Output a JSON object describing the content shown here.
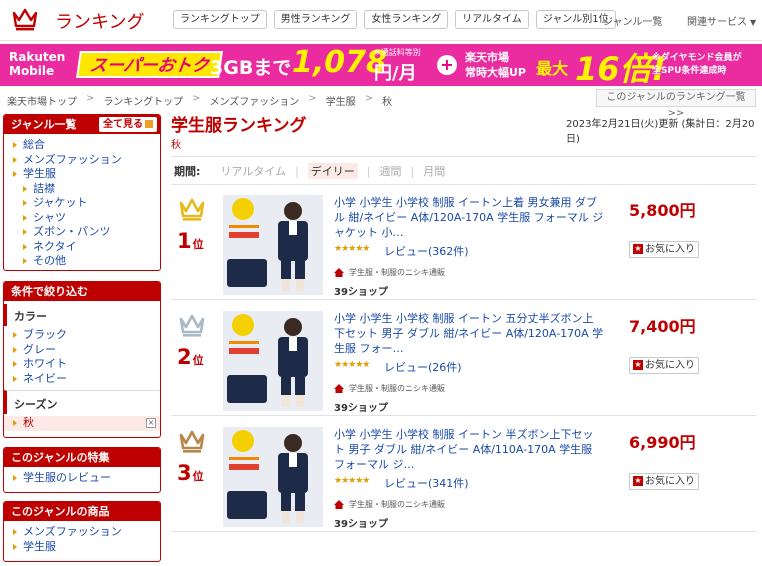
{
  "header": {
    "brand": "ランキング",
    "nav": [
      "ランキングトップ",
      "男性ランキング",
      "女性ランキング",
      "リアルタイム",
      "ジャンル別1位"
    ],
    "genre_list": "ジャンル一覧",
    "related_services": "関連サービス"
  },
  "banner": {
    "logo_line1": "Rakuten",
    "logo_line2": "Mobile",
    "super": "スーパーおトク",
    "gb": "3GBまで",
    "price": "1,078",
    "unit": "円/月",
    "note": "※通話料等別",
    "up_line1": "楽天市場",
    "up_line2": "常時大幅UP",
    "max": "最大",
    "times": "16倍!",
    "dia_line1": "※ダイヤモンド会員が",
    "dia_line2": "全SPU条件達成時"
  },
  "breadcrumb": [
    "楽天市場トップ",
    "ランキングトップ",
    "メンズファッション",
    "学生服",
    "秋"
  ],
  "genre_ranking_link": "このジャンルのランキング一覧 >>",
  "sidebar": {
    "genre_title": "ジャンル一覧",
    "see_all": "全て見る",
    "genres": [
      {
        "label": "総合",
        "level": 0
      },
      {
        "label": "メンズファッション",
        "level": 0
      },
      {
        "label": "学生服",
        "level": 0
      },
      {
        "label": "詰襟",
        "level": 1
      },
      {
        "label": "ジャケット",
        "level": 1
      },
      {
        "label": "シャツ",
        "level": 1
      },
      {
        "label": "ズボン・パンツ",
        "level": 1
      },
      {
        "label": "ネクタイ",
        "level": 1
      },
      {
        "label": "その他",
        "level": 1
      }
    ],
    "filter_title": "条件で絞り込む",
    "color_title": "カラー",
    "colors": [
      "ブラック",
      "グレー",
      "ホワイト",
      "ネイビー"
    ],
    "season_title": "シーズン",
    "season_selected": "秋",
    "feature_title": "このジャンルの特集",
    "features": [
      "学生服のレビュー"
    ],
    "products_title": "このジャンルの商品",
    "products": [
      "メンズファッション",
      "学生服"
    ]
  },
  "main": {
    "title": "学生服ランキング",
    "subtitle": "秋",
    "updated": "2023年2月21日(火)更新 (集計日：2月20日)",
    "period_label": "期間:",
    "periods": [
      "リアルタイム",
      "デイリー",
      "週間",
      "月間"
    ],
    "active_period": "デイリー"
  },
  "items": [
    {
      "rank": "1",
      "rank_suffix": "位",
      "crown_color": "#e8b71a",
      "title": "小学 小学生 小学校 制服 イートン上着 男女兼用 ダブル 紺/ネイビー A体/120A-170A 学生服 フォーマル ジャケット 小…",
      "stars": "★★★★★",
      "review": "レビュー(362件)",
      "shop_category": "学生服・制服のニシキ通販",
      "shop": "39ショップ",
      "price": "5,800円",
      "fav": "お気に入り"
    },
    {
      "rank": "2",
      "rank_suffix": "位",
      "crown_color": "#aab8c8",
      "title": "小学 小学生 小学校 制服 イートン 五分丈半ズボン上下セット 男子 ダブル 紺/ネイビー A体/120A-170A 学生服 フォー…",
      "stars": "★★★★★",
      "review": "レビュー(26件)",
      "shop_category": "学生服・制服のニシキ通販",
      "shop": "39ショップ",
      "price": "7,400円",
      "fav": "お気に入り"
    },
    {
      "rank": "3",
      "rank_suffix": "位",
      "crown_color": "#b8864a",
      "title": "小学 小学生 小学校 制服 イートン 半ズボン上下セット 男子 ダブル 紺/ネイビー A体/110A-170A 学生服 フォーマル ジ…",
      "stars": "★★★★★",
      "review": "レビュー(341件)",
      "shop_category": "学生服・制服のニシキ通販",
      "shop": "39ショップ",
      "price": "6,990円",
      "fav": "お気に入り"
    }
  ]
}
